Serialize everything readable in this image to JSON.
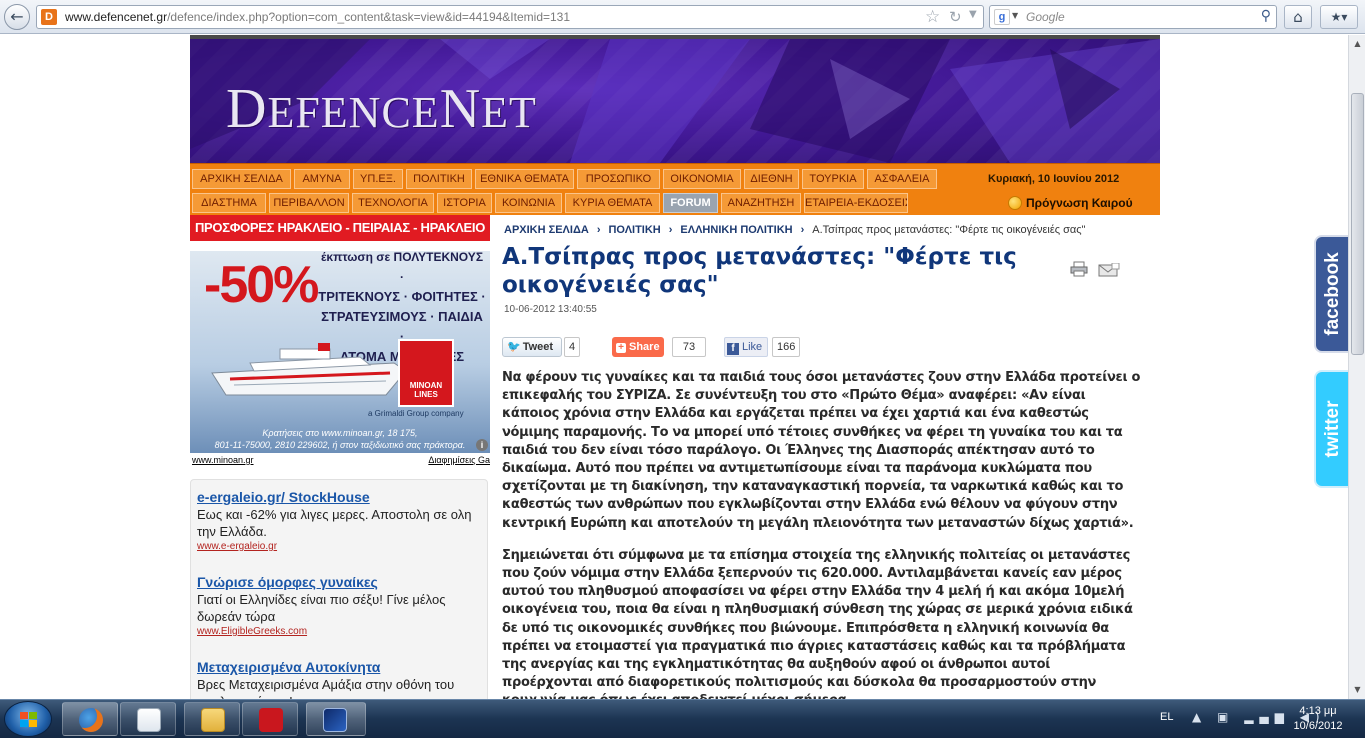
{
  "browser": {
    "back_glyph": "←",
    "url_domain": "www.defencenet.gr",
    "url_path": "/defence/index.php?option=com_content&task=view&id=44194&Itemid=131",
    "search_placeholder": "Google",
    "icons": [
      "back-icon",
      "favicon",
      "star-icon",
      "reload-icon",
      "google-icon",
      "search-icon",
      "home-icon",
      "bookmarks-icon"
    ]
  },
  "site": {
    "logo": "DEFENCENET",
    "menu_row1": [
      "ΑΡΧΙΚΗ ΣΕΛΙΔΑ",
      "ΑΜΥΝΑ",
      "ΥΠ.ΕΞ.",
      "ΠΟΛΙΤΙΚΗ",
      "ΕΘΝΙΚΑ ΘΕΜΑΤΑ",
      "ΠΡΟΣΩΠΙΚΟ",
      "ΟΙΚΟΝΟΜΙΑ",
      "ΔΙΕΘΝΗ",
      "ΤΟΥΡΚΙΑ",
      "ΑΣΦΑΛΕΙΑ"
    ],
    "menu_row2": [
      "ΔΙΑΣΤΗΜΑ",
      "ΠΕΡΙΒΑΛΛΟΝ",
      "ΤΕΧΝΟΛΟΓΙΑ",
      "ΙΣΤΟΡΙΑ",
      "ΚΟΙΝΩΝΙΑ",
      "ΚΥΡΙΑ ΘΕΜΑΤΑ",
      "FORUM",
      "ΑΝΑΖΗΤΗΣΗ",
      "ΕΤΑΙΡΕΙΑ-ΕΚΔΟΣΕΙΣ"
    ],
    "date": "Κυριακή, 10 Ιουνίου 2012",
    "weather_label": "Πρόγνωση Καιρού"
  },
  "ad": {
    "top": "ΠΡΟΣΦΟΡΕΣ ΗΡΑΚΛΕΙΟ - ΠΕΙΡΑΙΑΣ - ΗΡΑΚΛΕΙΟ",
    "discount": "-50%",
    "lines": [
      "έκπτωση σε ΠΟΛΥΤΕΚΝΟΥΣ ·",
      "ΤΡΙΤΕΚΝΟΥΣ · ΦΟΙΤΗΤΕΣ ·",
      "ΣΤΡΑΤΕΥΣΙΜΟΥΣ · ΠΑΙΔΙΑ ·",
      "ΑΤΟΜΑ ΜΕ ΕΙΔΙΚΕΣ ΑΝΑΓΚΕΣ"
    ],
    "logo_text": "MINOAN LINES",
    "grimaldi": "a Grimaldi Group company",
    "footer1": "Κρατήσεις στο www.minoan.gr, 18 175,",
    "footer2": "801-11-75000, 2810 229602, ή στον ταξιδιωτικό σας πράκτορα.",
    "link_left": "www.minoan.gr",
    "link_right": "Διαφημίσεις Ga"
  },
  "textads": [
    {
      "title": "e-ergaleio.gr/ StockHouse",
      "desc": "Εως και -62% για λιγες μερες. Αποστολη σε ολη την Ελλάδα.",
      "url": "www.e-ergaleio.gr"
    },
    {
      "title": "Γνώρισε όμορφες γυναίκες",
      "desc": "Γιατί οι Ελληνίδες είναι πιο σέξυ! Γίνε μέλος δωρεάν τώρα",
      "url": "www.EligibleGreeks.com"
    },
    {
      "title": "Μεταχειρισμένα Αυτοκίνητα",
      "desc": "Βρες Μεταχειρισμένα Αμάξια στην οθόνη του υπολογιστή σου!",
      "url": ""
    }
  ],
  "article": {
    "breadcrumb": [
      "ΑΡΧΙΚΗ ΣΕΛΙΔΑ",
      "ΠΟΛΙΤΙΚΗ",
      "ΕΛΛΗΝΙΚΗ ΠΟΛΙΤΙΚΗ",
      "Α.Τσίπρας προς μετανάστες: \"Φέρτε τις οικογένειές σας\""
    ],
    "title": "Α.Τσίπρας προς μετανάστες: \"Φέρτε τις οικογένειές σας\"",
    "date": "10-06-2012 13:40:55",
    "tweet_label": "Tweet",
    "tweet_count": "4",
    "share_label": "Share",
    "share_count": "73",
    "like_label": "Like",
    "like_count": "166",
    "p1": "Να φέρουν τις γυναίκες και τα παιδιά τους όσοι μετανάστες ζουν στην Ελλάδα προτείνει ο επικεφαλής του ΣΥΡΙΖΑ. Σε συνέντευξη του στο «Πρώτο Θέμα» αναφέρει: «Αν είναι κάποιος χρόνια στην Ελλάδα και εργάζεται πρέπει να έχει χαρτιά και ένα καθεστώς νόμιμης παραμονής. Το να μπορεί υπό τέτοιες συνθήκες να φέρει τη γυναίκα του και τα παιδιά του δεν είναι τόσο παράλογο. Οι Έλληνες της Διασποράς απέκτησαν αυτό το δικαίωμα. Αυτό που πρέπει να αντιμετωπίσουμε είναι τα παράνομα κυκλώματα που σχετίζονται με τη διακίνηση, την καταναγκαστική πορνεία, τα ναρκωτικά καθώς και το καθεστώς των ανθρώπων που εγκλωβίζονται στην Ελλάδα ενώ θέλουν να φύγουν στην κεντρική Ευρώπη και αποτελούν τη μεγάλη πλειονότητα των μεταναστών δίχως χαρτιά».",
    "p2": "Σημειώνεται ότι σύμφωνα με τα επίσημα στοιχεία της ελληνικής πολιτείας οι μετανάστες που ζούν νόμιμα στην Ελλάδα ξεπερνούν τις 620.000. Αντιλαμβάνεται κανείς εαν μέρος αυτού του πληθυσμού αποφασίσει να φέρει στην Ελλάδα την 4 μελή ή και ακόμα 10μελή οικογένεια του, ποια θα είναι η πληθυσμιακή σύνθεση της χώρας σε μερικά χρόνια ειδικά δε υπό τις οικονομικές συνθήκες που βιώνουμε. Επιπρόσθετα η ελληνική κοινωνία θα πρέπει να ετοιμαστεί για πραγματικά πιο άγριες καταστάσεις καθώς και τα πρόβλήματα της ανεργίας και της εγκληματικότητας θα αυξηθούν αφού οι άνθρωποι αυτοί προέρχονται από διαφορετικούς πολιτισμούς και δύσκολα θα προσαρμοστούν στην κοινωνία μας όπως έχει αποδειχτεί μέχρι σήμερα."
  },
  "social": {
    "facebook": "facebook",
    "twitter": "twitter"
  },
  "taskbar": {
    "apps": [
      "firefox",
      "media-player",
      "explorer",
      "acrobat",
      "defencenet"
    ],
    "lang": "EL",
    "time": "4:13 μμ",
    "date": "10/6/2012"
  }
}
